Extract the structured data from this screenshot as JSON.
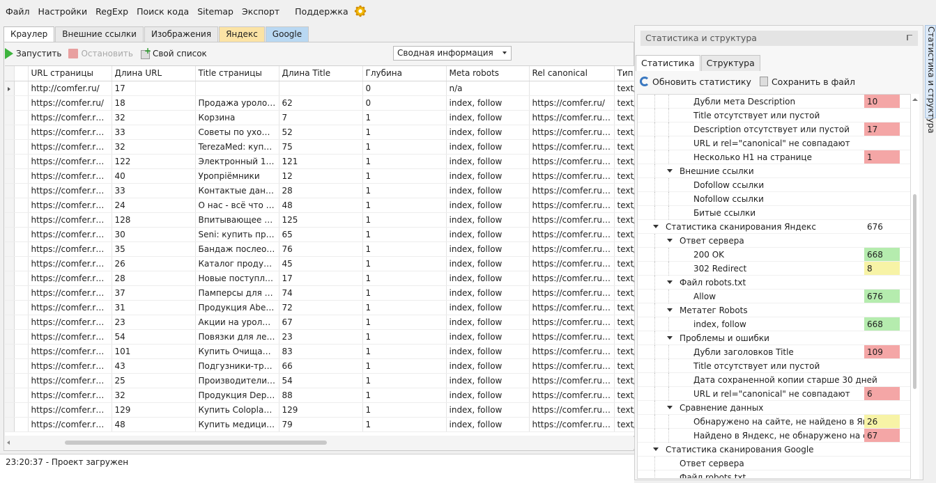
{
  "menu": [
    "Файл",
    "Настройки",
    "RegExp",
    "Поиск кода",
    "Sitemap",
    "Экспорт",
    "Поддержка"
  ],
  "left_tabs": [
    "Краулер",
    "Внешние ссылки",
    "Изображения",
    "Яндекс",
    "Google"
  ],
  "toolbar": {
    "start": "Запустить",
    "stop": "Остановить",
    "own_list": "Свой список"
  },
  "view_select": "Сводная информация",
  "grid": {
    "columns": [
      "URL страницы",
      "Длина URL",
      "Title страницы",
      "Длина Title",
      "Глубина",
      "Meta robots",
      "Rel canonical",
      "Тип к"
    ],
    "rows": [
      [
        "http://comfer.ru/",
        "17",
        "",
        "",
        "0",
        "n/a",
        "",
        "text/"
      ],
      [
        "https://comfer.ru/",
        "18",
        "Продажа урологи...",
        "62",
        "0",
        "index, follow",
        "https://comfer.ru/",
        "text/"
      ],
      [
        "https://comfer.ru/p...",
        "32",
        "Корзина",
        "7",
        "1",
        "index, follow",
        "https://comfer.ru/p...",
        "text/"
      ],
      [
        "https://comfer.ru/a...",
        "33",
        "Советы по уходу з...",
        "52",
        "1",
        "index, follow",
        "https://comfer.ru/a...",
        "text/"
      ],
      [
        "https://comfer.ru/b...",
        "32",
        "TerezaMed: купить...",
        "75",
        "1",
        "index, follow",
        "https://comfer.ru/b...",
        "text/"
      ],
      [
        "https://comfer.ru/c...",
        "122",
        "Электронный 10-с...",
        "121",
        "1",
        "index, follow",
        "https://comfer.ru/c...",
        "text/"
      ],
      [
        "https://comfer.ru/c...",
        "40",
        "Уропріёмники",
        "12",
        "1",
        "index, follow",
        "https://comfer.ru/c...",
        "text/"
      ],
      [
        "https://comfer.ru/a...",
        "33",
        "Контактые данны...",
        "28",
        "1",
        "index, follow",
        "https://comfer.ru/a...",
        "text/"
      ],
      [
        "https://comfer.ru/a...",
        "24",
        "О нас - всё что ну...",
        "48",
        "1",
        "index, follow",
        "https://comfer.ru/a...",
        "text/"
      ],
      [
        "https://comfer.ru/c...",
        "128",
        "Впитывающее ни...",
        "125",
        "1",
        "index, follow",
        "https://comfer.ru/c...",
        "text/"
      ],
      [
        "https://comfer.ru/b...",
        "30",
        "Seni: купить проду...",
        "65",
        "1",
        "index, follow",
        "https://comfer.ru/b...",
        "text/"
      ],
      [
        "https://comfer.ru/c...",
        "35",
        "Бандаж послеопе...",
        "76",
        "1",
        "index, follow",
        "https://comfer.ru/c...",
        "text/"
      ],
      [
        "https://comfer.ru/c...",
        "26",
        "Каталог продукци...",
        "45",
        "1",
        "index, follow",
        "https://comfer.ru/c...",
        "text/"
      ],
      [
        "https://comfer.ru/n...",
        "28",
        "Новые поступления",
        "17",
        "1",
        "index, follow",
        "https://comfer.ru/n...",
        "text/"
      ],
      [
        "https://comfer.ru/c...",
        "37",
        "Памперсы для взр...",
        "74",
        "1",
        "index, follow",
        "https://comfer.ru/c...",
        "text/"
      ],
      [
        "https://comfer.ru/b...",
        "31",
        "Продукция Abena:...",
        "72",
        "1",
        "index, follow",
        "https://comfer.ru/b...",
        "text/"
      ],
      [
        "https://comfer.ru/s...",
        "23",
        "Акции на урологи...",
        "67",
        "1",
        "index, follow",
        "https://comfer.ru/s...",
        "text/"
      ],
      [
        "https://comfer.ru/c...",
        "54",
        "Повязки для лече...",
        "23",
        "1",
        "index, follow",
        "https://comfer.ru/c...",
        "text/"
      ],
      [
        "https://comfer.ru/c...",
        "101",
        "Купить Очищающ...",
        "83",
        "1",
        "index, follow",
        "https://comfer.ru/c...",
        "text/"
      ],
      [
        "https://comfer.ru/c...",
        "43",
        "Подгузники-труси...",
        "66",
        "1",
        "index, follow",
        "https://comfer.ru/c...",
        "text/"
      ],
      [
        "https://comfer.ru/b...",
        "25",
        "Производители -...",
        "54",
        "1",
        "index, follow",
        "https://comfer.ru/b...",
        "text/"
      ],
      [
        "https://comfer.ru/b...",
        "32",
        "Продукция Depen...",
        "88",
        "1",
        "index, follow",
        "https://comfer.ru/b...",
        "text/"
      ],
      [
        "https://comfer.ru/c...",
        "129",
        "Купить Coloplast A...",
        "129",
        "1",
        "index, follow",
        "https://comfer.ru/c...",
        "text/"
      ],
      [
        "https://comfer.ru/c...",
        "48",
        "Купить медицинск...",
        "79",
        "1",
        "index, follow",
        "https://comfer.ru/c...",
        "text/"
      ]
    ]
  },
  "status": "23:20:37 - Проект загружен",
  "right_panel": {
    "title": "Статистика и структура",
    "tabs": [
      "Статистика",
      "Структура"
    ],
    "refresh": "Обновить статистику",
    "save": "Сохранить в файл",
    "side_tab": "Статистика и структура",
    "tree": [
      {
        "label": "Дубли мета Description",
        "level": 3,
        "value": "10",
        "color": "red"
      },
      {
        "label": "Title отсутствует или пустой",
        "level": 3,
        "value": "",
        "color": "plain"
      },
      {
        "label": "Description отсутствует или пустой",
        "level": 3,
        "value": "17",
        "color": "red"
      },
      {
        "label": "URL и rel=\"canonical\" не совпадают",
        "level": 3,
        "value": "",
        "color": "plain"
      },
      {
        "label": "Несколько H1 на странице",
        "level": 3,
        "value": "1",
        "color": "red"
      },
      {
        "label": "Внешние ссылки",
        "level": 2,
        "value": "",
        "color": "plain",
        "expanded": true
      },
      {
        "label": "Dofollow ссылки",
        "level": 3,
        "value": "",
        "color": "plain"
      },
      {
        "label": "Nofollow ссылки",
        "level": 3,
        "value": "",
        "color": "plain"
      },
      {
        "label": "Битые ссылки",
        "level": 3,
        "value": "",
        "color": "plain"
      },
      {
        "label": "Статистика сканирования Яндекс",
        "level": 1,
        "value": "676",
        "color": "plain",
        "expanded": true
      },
      {
        "label": "Ответ сервера",
        "level": 2,
        "value": "",
        "color": "plain",
        "expanded": true
      },
      {
        "label": "200 OK",
        "level": 3,
        "value": "668",
        "color": "green"
      },
      {
        "label": "302 Redirect",
        "level": 3,
        "value": "8",
        "color": "yellow"
      },
      {
        "label": "Файл robots.txt",
        "level": 2,
        "value": "",
        "color": "plain",
        "expanded": true
      },
      {
        "label": "Allow",
        "level": 3,
        "value": "676",
        "color": "green"
      },
      {
        "label": "Метатег Robots",
        "level": 2,
        "value": "",
        "color": "plain",
        "expanded": true
      },
      {
        "label": "index, follow",
        "level": 3,
        "value": "668",
        "color": "green"
      },
      {
        "label": "Проблемы и ошибки",
        "level": 2,
        "value": "",
        "color": "plain",
        "expanded": true
      },
      {
        "label": "Дубли заголовков Title",
        "level": 3,
        "value": "109",
        "color": "red"
      },
      {
        "label": "Title отсутствует или пустой",
        "level": 3,
        "value": "",
        "color": "plain"
      },
      {
        "label": "Дата сохраненной копии старше 30 дней",
        "level": 3,
        "value": "",
        "color": "plain"
      },
      {
        "label": "URL и rel=\"canonical\" не совпадают",
        "level": 3,
        "value": "6",
        "color": "red"
      },
      {
        "label": "Сравнение данных",
        "level": 2,
        "value": "",
        "color": "plain",
        "expanded": true
      },
      {
        "label": "Обнаружено на сайте, не найдено в Яндекс",
        "level": 3,
        "value": "26",
        "color": "yellow"
      },
      {
        "label": "Найдено в Яндекс, не обнаружено на сайте",
        "level": 3,
        "value": "67",
        "color": "red"
      },
      {
        "label": "Статистика сканирования Google",
        "level": 1,
        "value": "",
        "color": "plain",
        "expanded": true
      },
      {
        "label": "Ответ сервера",
        "level": 2,
        "value": "",
        "color": "plain"
      },
      {
        "label": "Файл robots.txt",
        "level": 2,
        "value": "",
        "color": "plain"
      }
    ]
  }
}
